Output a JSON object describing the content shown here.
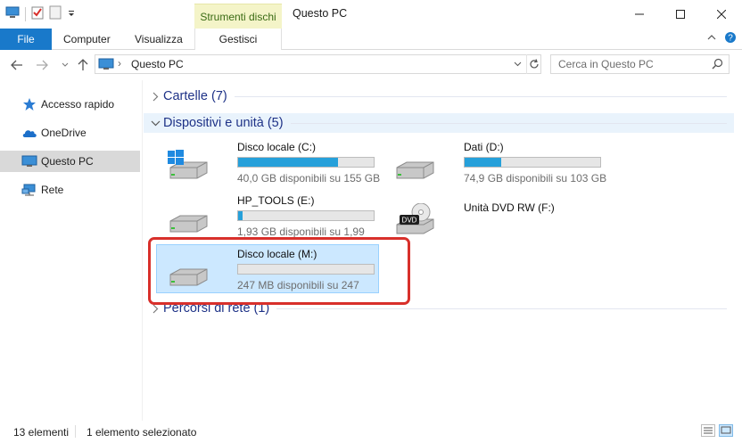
{
  "window": {
    "title": "Questo PC",
    "context_tab": "Strumenti dischi"
  },
  "ribbon": {
    "file": "File",
    "computer": "Computer",
    "view": "Visualizza",
    "manage": "Gestisci"
  },
  "address": {
    "path": "Questo PC",
    "search_placeholder": "Cerca in Questo PC"
  },
  "nav": {
    "items": [
      {
        "label": "Accesso rapido",
        "icon": "star-icon"
      },
      {
        "label": "OneDrive",
        "icon": "cloud-icon"
      },
      {
        "label": "Questo PC",
        "icon": "computer-icon",
        "selected": true
      },
      {
        "label": "Rete",
        "icon": "network-icon"
      }
    ]
  },
  "groups": {
    "folders": "Cartelle (7)",
    "devices": "Dispositivi e unità (5)",
    "network": "Percorsi di rete (1)"
  },
  "drives": [
    {
      "name": "Disco locale (C:)",
      "sub": "40,0 GB disponibili su 155 GB",
      "used_fraction": 0.74,
      "icon": "windows-drive-icon"
    },
    {
      "name": "Dati (D:)",
      "sub": "74,9 GB disponibili su 103 GB",
      "used_fraction": 0.27,
      "icon": "hard-drive-icon"
    },
    {
      "name": "HP_TOOLS (E:)",
      "sub": "1,93 GB disponibili su 1,99",
      "used_fraction": 0.03,
      "icon": "hard-drive-icon"
    },
    {
      "name": "Unità DVD RW (F:)",
      "sub": "",
      "icon": "dvd-drive-icon"
    },
    {
      "name": "Disco locale (M:)",
      "sub": "247 MB disponibili su 247",
      "used_fraction": 0.0,
      "icon": "hard-drive-icon",
      "selected": true
    }
  ],
  "status": {
    "count": "13 elementi",
    "selection": "1 elemento selezionato"
  },
  "colors": {
    "accent": "#1979ca",
    "bar_fill": "#26a0da",
    "selection": "#cce8ff",
    "highlight_frame": "#d8302b",
    "group_title": "#1e3287"
  }
}
